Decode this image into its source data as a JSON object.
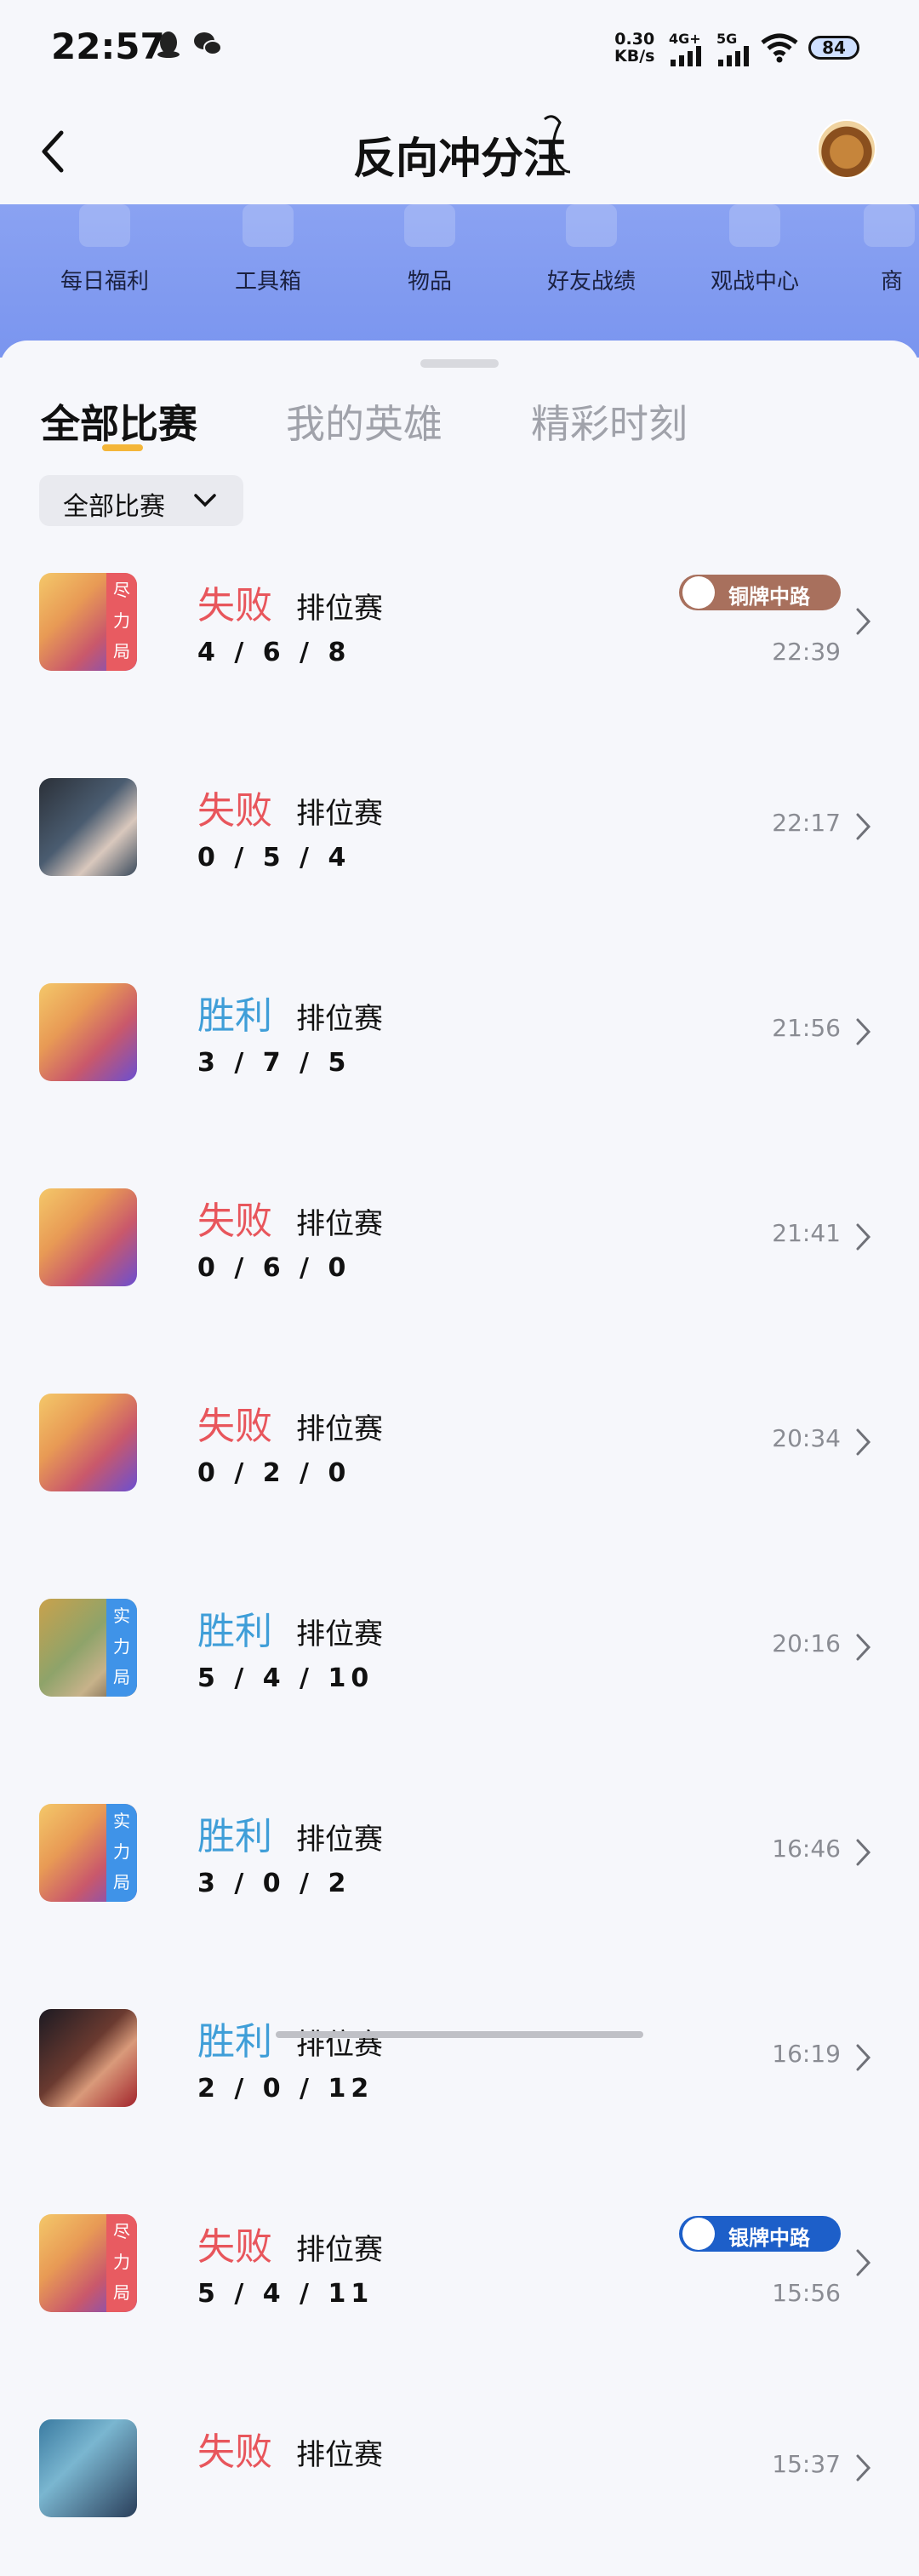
{
  "status": {
    "time": "22:57",
    "speed_top": "0.30",
    "speed_bottom": "KB/s",
    "net1": "4G+",
    "net2": "5G",
    "battery": "84"
  },
  "header": {
    "title": "反向冲分汪"
  },
  "banner": {
    "items": [
      "每日福利",
      "工具箱",
      "物品",
      "好友战绩",
      "观战中心",
      "商"
    ]
  },
  "tabs": [
    "全部比赛",
    "我的英雄",
    "精彩时刻"
  ],
  "filter": {
    "label": "全部比赛"
  },
  "colors": {
    "lose": "#e8565c",
    "win": "#3f9ed8",
    "accent": "#f4b639"
  },
  "matches": [
    {
      "result": "失败",
      "outcome": "lose",
      "mode": "排位赛",
      "kda": "4 / 6 / 8",
      "time": "22:39",
      "tag": "尽力局",
      "tag_color": "red",
      "medal": "铜牌中路",
      "medal_type": "bronze",
      "hero": "blonde-mage"
    },
    {
      "result": "失败",
      "outcome": "lose",
      "mode": "排位赛",
      "kda": "0 / 5 / 4",
      "time": "22:17",
      "tag": "",
      "hero": "dark-hair-warrior"
    },
    {
      "result": "胜利",
      "outcome": "win",
      "mode": "排位赛",
      "kda": "3 / 7 / 5",
      "time": "21:56",
      "tag": "",
      "hero": "blonde-mage"
    },
    {
      "result": "失败",
      "outcome": "lose",
      "mode": "排位赛",
      "kda": "0 / 6 / 0",
      "time": "21:41",
      "tag": "",
      "hero": "blonde-mage"
    },
    {
      "result": "失败",
      "outcome": "lose",
      "mode": "排位赛",
      "kda": "0 / 2 / 0",
      "time": "20:34",
      "tag": "",
      "hero": "blonde-mage"
    },
    {
      "result": "胜利",
      "outcome": "win",
      "mode": "排位赛",
      "kda": "5 / 4 / 10",
      "time": "20:16",
      "tag": "实力局",
      "tag_color": "blue",
      "hero": "gold-helmet"
    },
    {
      "result": "胜利",
      "outcome": "win",
      "mode": "排位赛",
      "kda": "3 / 0 / 2",
      "time": "16:46",
      "tag": "实力局",
      "tag_color": "blue",
      "hero": "blonde-mage"
    },
    {
      "result": "胜利",
      "outcome": "win",
      "mode": "排位赛",
      "kda": "2 / 0 / 12",
      "time": "16:19",
      "tag": "",
      "hero": "red-scarf-boy"
    },
    {
      "result": "失败",
      "outcome": "lose",
      "mode": "排位赛",
      "kda": "5 / 4 / 11",
      "time": "15:56",
      "tag": "尽力局",
      "tag_color": "red",
      "medal": "银牌中路",
      "medal_type": "silver",
      "hero": "blonde-mage"
    },
    {
      "result": "失败",
      "outcome": "lose",
      "mode": "排位赛",
      "kda": "",
      "time": "15:37",
      "tag": "",
      "hero": "blue-hair-warrior"
    }
  ]
}
